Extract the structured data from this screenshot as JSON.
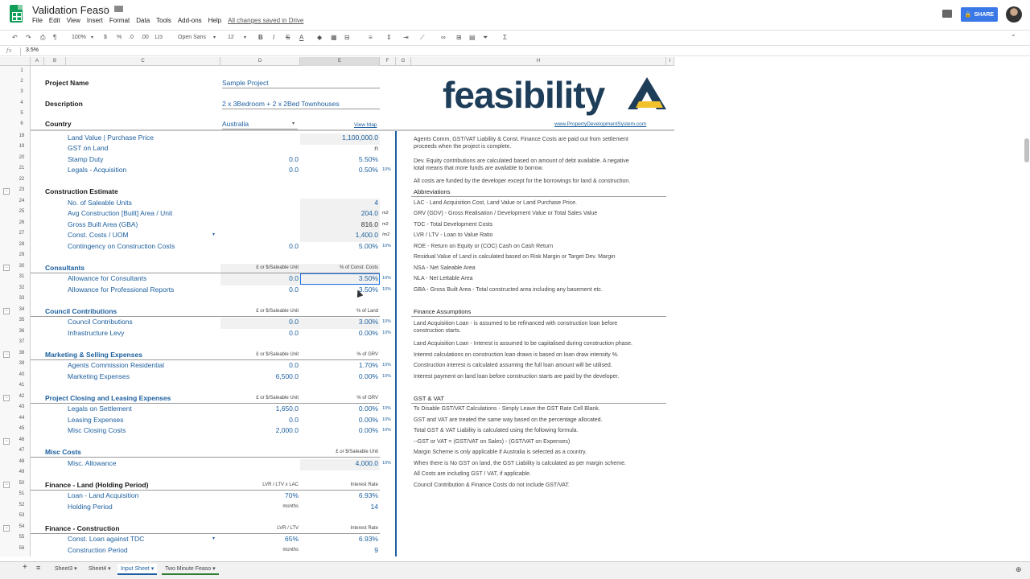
{
  "title_bar": {
    "doc_title": "Validation Feaso",
    "menus": [
      "File",
      "Edit",
      "View",
      "Insert",
      "Format",
      "Data",
      "Tools",
      "Add-ons",
      "Help"
    ],
    "saved_status": "All changes saved in Drive",
    "share_label": "SHARE"
  },
  "toolbar": {
    "zoom": "100%",
    "currency": "$",
    "percent": "%",
    "decimal_dec": ".0",
    "decimal_inc": ".00",
    "more_formats": "123",
    "font": "Open Sans",
    "font_size": "12",
    "bold": "B",
    "italic": "I",
    "strike": "S",
    "text_color": "A"
  },
  "formula_bar": {
    "fx": "fx",
    "value": "3.5%"
  },
  "columns": [
    "A",
    "B",
    "C",
    "D",
    "E",
    "F",
    "G",
    "H",
    "I"
  ],
  "header_rows": {
    "project_name_label": "Project Name",
    "project_name_value": "Sample Project",
    "description_label": "Description",
    "description_value": "2 x 3Bedroom + 2 x 2Bed Townhouses",
    "country_label": "Country",
    "country_value": "Australia",
    "view_map": "View Map",
    "logo_text": "feasibility",
    "logo_url": "www.PropertyDevelopmentSystem.com"
  },
  "row_numbers": [
    "1",
    "2",
    "3",
    "4",
    "5",
    "6",
    "18",
    "19",
    "20",
    "21",
    "22",
    "23",
    "24",
    "25",
    "26",
    "27",
    "28",
    "29",
    "30",
    "31",
    "32",
    "33",
    "34",
    "35",
    "36",
    "37",
    "38",
    "39",
    "40",
    "41",
    "42",
    "43",
    "44",
    "45",
    "46",
    "47",
    "48",
    "49",
    "50",
    "51",
    "52",
    "53",
    "54",
    "55",
    "56"
  ],
  "land": [
    {
      "label": "Land Value | Purchase Price",
      "d": "",
      "e": "1,100,000.0",
      "f": ""
    },
    {
      "label": "GST on Land",
      "d": "",
      "e": "n",
      "f": ""
    },
    {
      "label": "Stamp Duty",
      "d": "0.0",
      "e": "5.50%",
      "f": ""
    },
    {
      "label": "Legals - Acquisition",
      "d": "0.0",
      "e": "0.50%",
      "f": "10%"
    }
  ],
  "construction": {
    "heading": "Construction Estimate",
    "rows": [
      {
        "label": "No. of Saleable Units",
        "d": "",
        "e": "4",
        "f": ""
      },
      {
        "label": "Avg Construction [Built] Area / Unit",
        "d": "",
        "e": "204.0",
        "f": "m2"
      },
      {
        "label": "Gross Built Area (GBA)",
        "d": "",
        "e": "816.0",
        "f": "m2"
      },
      {
        "label": "Const. Costs / UOM",
        "d": "",
        "e": "1,400.0",
        "f": "/m2"
      },
      {
        "label": "Contingency on Construction Costs",
        "d": "0.0",
        "e": "5.00%",
        "f": "10%"
      }
    ]
  },
  "consultants": {
    "heading": "Consultants",
    "col_d": "£ or $/Saleable Unit",
    "col_e": "% of Const. Costs",
    "rows": [
      {
        "label": "Allowance for Consultants",
        "d": "0.0",
        "e": "3.50%",
        "f": "10%"
      },
      {
        "label": "Allowance for Professional Reports",
        "d": "0.0",
        "e": "3.50%",
        "f": "10%"
      }
    ]
  },
  "council": {
    "heading": "Council Contributions",
    "col_d": "£ or $/Saleable Unit",
    "col_e": "% of Land",
    "rows": [
      {
        "label": "Council Contributions",
        "d": "0.0",
        "e": "3.00%",
        "f": "10%"
      },
      {
        "label": "Infrastructure Levy",
        "d": "0.0",
        "e": "0.00%",
        "f": "10%"
      }
    ]
  },
  "marketing": {
    "heading": "Marketing & Selling Expenses",
    "col_d": "£ or $/Saleable Unit",
    "col_e": "% of GRV",
    "rows": [
      {
        "label": "Agents Commission Residential",
        "d": "0.0",
        "e": "1.70%",
        "f": "10%"
      },
      {
        "label": "Marketing Expenses",
        "d": "6,500.0",
        "e": "0.00%",
        "f": "10%"
      }
    ]
  },
  "closing": {
    "heading": "Project Closing and Leasing Expenses",
    "col_d": "£ or $/Saleable Unit",
    "col_e": "% of GRV",
    "rows": [
      {
        "label": "Legals on Settlement",
        "d": "1,650.0",
        "e": "0.00%",
        "f": "10%"
      },
      {
        "label": "Leasing Expenses",
        "d": "0.0",
        "e": "0.00%",
        "f": "10%"
      },
      {
        "label": "Misc Closing Costs",
        "d": "2,000.0",
        "e": "0.00%",
        "f": "10%"
      }
    ]
  },
  "misc": {
    "heading": "Misc Costs",
    "col_e": "£ or $/Saleable Unit",
    "rows": [
      {
        "label": "Misc. Allowance",
        "d": "",
        "e": "4,000.0",
        "f": "10%"
      }
    ]
  },
  "finance_land": {
    "heading": "Finance - Land (Holding Period)",
    "col_d": "LVR / LTV x LAC",
    "col_e": "Interest Rate",
    "rows": [
      {
        "label": "Loan - Land Acquisition",
        "d": "70%",
        "e": "6.93%",
        "f": ""
      },
      {
        "label": "Holding Period",
        "d": "months",
        "e": "14",
        "f": ""
      }
    ]
  },
  "finance_construction": {
    "heading": "Finance - Construction",
    "col_d": "LVR / LTV",
    "col_e": "Interest Rate",
    "rows": [
      {
        "label": "Const. Loan against TDC",
        "d": "65%",
        "e": "6.93%",
        "f": ""
      },
      {
        "label": "Construction Period",
        "d": "months",
        "e": "9",
        "f": ""
      }
    ]
  },
  "notes": {
    "top": [
      "Agents Comm, GST/VAT Liability & Const. Finance Costs are paid out from settlement",
      "proceeds when the project is complete.",
      "Dev. Equity contributions are calculated based on amount of debt available. A negative",
      "total means that more funds are available to borrow.",
      "All costs are funded by the developer except for the borrowings for land & construction."
    ],
    "abbreviations_heading": "Abbreviations",
    "abbreviations": [
      "LAC - Land Acquisition Cost, Land Value or Land Purchase Price.",
      "GRV (GDV) - Gross Realisation / Development Value or Total Sales Value",
      "TDC - Total Development Costs",
      "LVR / LTV - Loan to Value Ratio",
      "ROE - Return on Equity or (COC) Cash on Cash Return",
      "Residual Value of Land is calculated based on Risk Margin or Target Dev. Margin",
      "NSA - Net Saleable Area",
      "NLA - Net Lettable Area",
      "GBA - Gross Built Area - Total constructed area including any basement etc."
    ],
    "finance_heading": "Finance Assumptions",
    "finance": [
      "Land Acquisition Loan - is assumed to be refinanced with construction loan before",
      "construction starts.",
      "Land Acquisition Loan - Interest is assumed to be capitalised during construction phase.",
      "Interest calculations on construction loan draws is based on loan draw intensity %.",
      "Construction interest is calculated assuming the full loan amount will be utilised.",
      "Interest payment on land loan before construction starts are paid by the developer."
    ],
    "gst_heading": "GST & VAT",
    "gst": [
      "To Disable GST/VAT Calculations - Simply Leave the GST Rate Cell Blank.",
      "GST and VAT are treated the same way based on the percentage allocated.",
      "Total GST & VAT Liability is calculated using the following formula.",
      "--GST or VAT = (GST/VAT on Sales) - (GST/VAT on Expenses)",
      "Margin Scheme is only applicable if Australia is selected as a country.",
      "When there is No GST on land, the GST Liability is calculated as per margin scheme.",
      "All Costs are including GST / VAT, if applicable.",
      "Council Contribution & Finance Costs do not include GST/VAT."
    ]
  },
  "tabs": [
    "Sheet3",
    "Sheet4",
    "Input Sheet",
    "Two Minute Feaso"
  ],
  "active_tab": "Input Sheet",
  "colors": {
    "accent": "#1c5f9e",
    "logo": "#1e3d59",
    "logo_yellow": "#f2c12e",
    "share": "#3b78e7"
  }
}
